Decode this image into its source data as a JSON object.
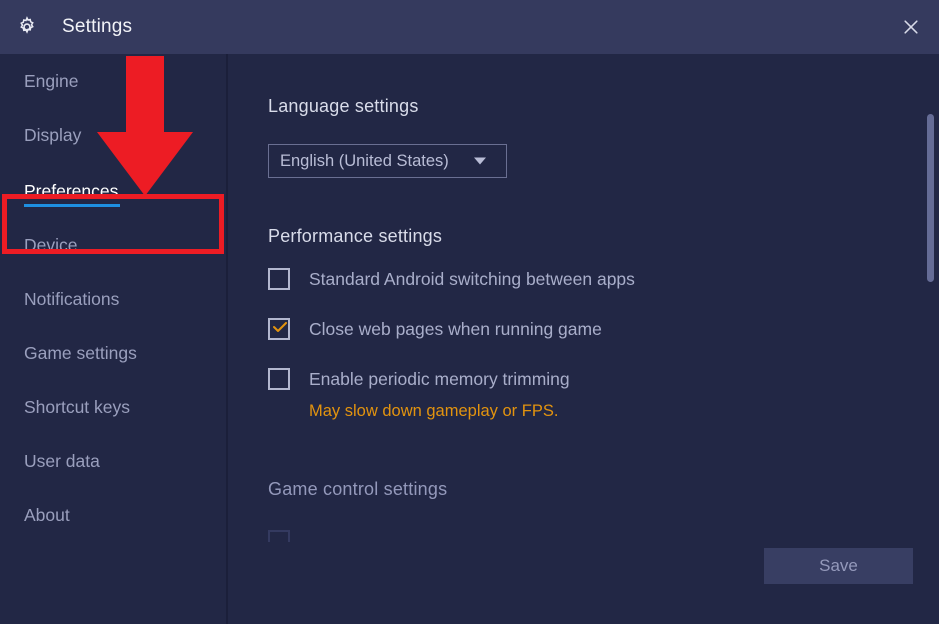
{
  "window": {
    "title": "Settings",
    "gear_icon": "gear-icon",
    "close_icon": "close-icon"
  },
  "sidebar": {
    "items": [
      {
        "label": "Engine",
        "active": false
      },
      {
        "label": "Display",
        "active": false
      },
      {
        "label": "Preferences",
        "active": true
      },
      {
        "label": "Device",
        "active": false
      },
      {
        "label": "Notifications",
        "active": false
      },
      {
        "label": "Game settings",
        "active": false
      },
      {
        "label": "Shortcut keys",
        "active": false
      },
      {
        "label": "User data",
        "active": false
      },
      {
        "label": "About",
        "active": false
      }
    ]
  },
  "content": {
    "language_section": {
      "heading": "Language settings",
      "select_value": "English (United States)",
      "caret_icon": "chevron-down-icon"
    },
    "performance_section": {
      "heading": "Performance settings",
      "options": [
        {
          "label": "Standard Android switching between apps",
          "checked": false
        },
        {
          "label": "Close web pages when running game",
          "checked": true
        },
        {
          "label": "Enable periodic memory trimming",
          "checked": false
        }
      ],
      "warning": "May slow down gameplay or FPS."
    },
    "game_control_section": {
      "heading": "Game control settings"
    }
  },
  "footer": {
    "save_label": "Save"
  },
  "colors": {
    "window_background": "#222745",
    "titlebar_background": "#353a5e",
    "accent_blue": "#1e8fe1",
    "warning_orange": "#e2930f",
    "annotation_red": "#ed1c24",
    "save_button_background": "#383e63"
  }
}
